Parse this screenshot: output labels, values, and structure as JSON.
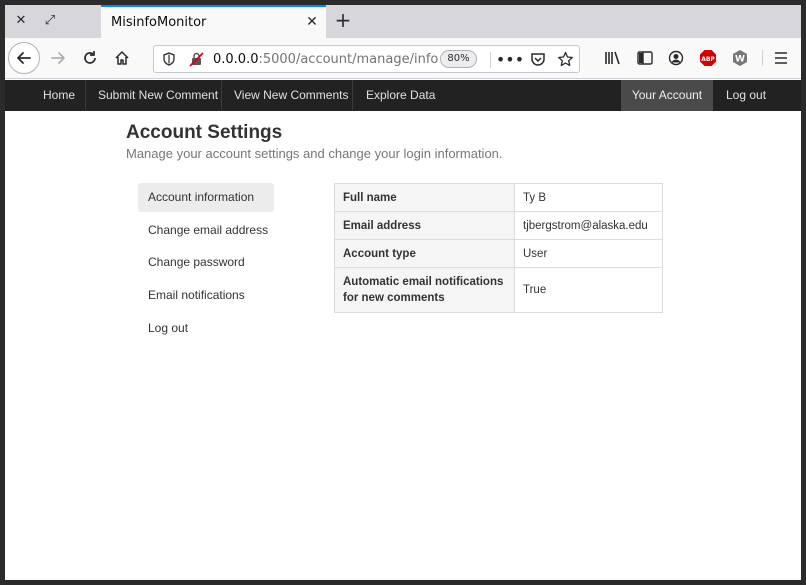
{
  "browser": {
    "tab_title": "MisinfoMonitor",
    "url_host": "0.0.0.0",
    "url_path": ":5000/account/manage/info",
    "zoom": "80%"
  },
  "site_nav": {
    "items": [
      "Home",
      "Submit New Comment",
      "View New Comments",
      "Explore Data"
    ],
    "account": "Your Account",
    "logout": "Log out"
  },
  "page": {
    "title": "Account Settings",
    "subtitle": "Manage your account settings and change your login information."
  },
  "sidebar": {
    "items": [
      {
        "label": "Account information"
      },
      {
        "label": "Change email address"
      },
      {
        "label": "Change password"
      },
      {
        "label": "Email notifications"
      },
      {
        "label": "Log out"
      }
    ]
  },
  "info_table": {
    "rows": [
      {
        "key": "Full name",
        "value": "Ty B"
      },
      {
        "key": "Email address",
        "value": "tjbergstrom@alaska.edu"
      },
      {
        "key": "Account type",
        "value": "User"
      },
      {
        "key": "Automatic email notifications for new comments",
        "value": "True"
      }
    ]
  }
}
